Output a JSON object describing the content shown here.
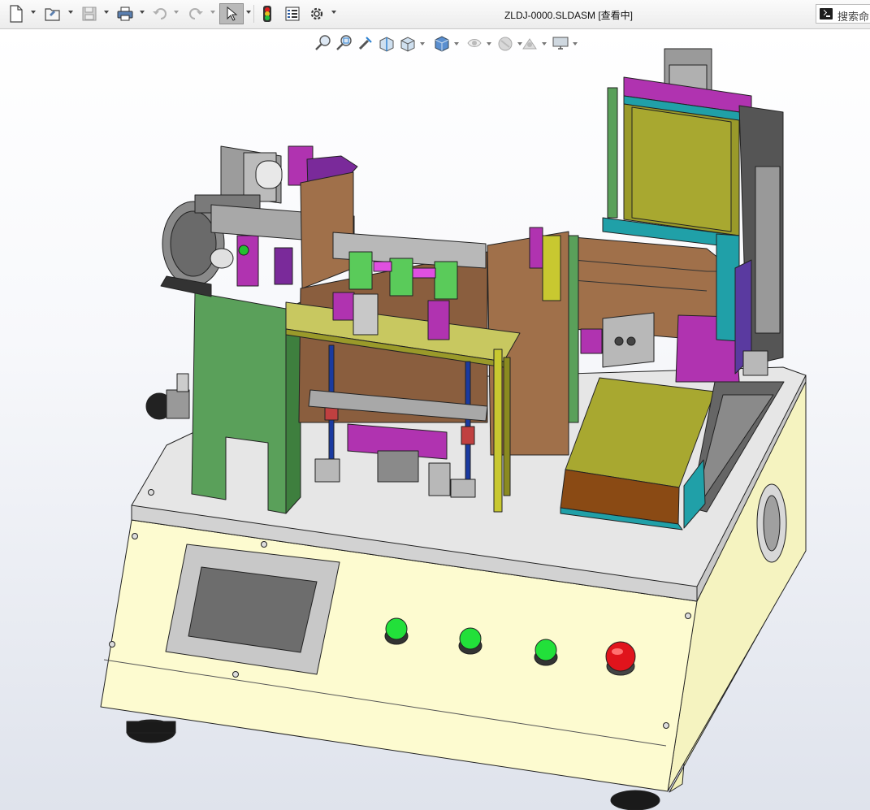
{
  "app": {
    "title": "ZLDJ-0000.SLDASM [查看中]"
  },
  "toolbar": {
    "items": [
      {
        "name": "new-document",
        "icon": "new-document-icon"
      },
      {
        "name": "open",
        "icon": "open-folder-icon"
      },
      {
        "name": "save",
        "icon": "save-disk-icon"
      },
      {
        "name": "print",
        "icon": "printer-icon"
      },
      {
        "name": "undo",
        "icon": "undo-arrow-icon"
      },
      {
        "name": "redo",
        "icon": "redo-arrow-icon"
      },
      {
        "name": "select",
        "icon": "cursor-arrow-icon"
      },
      {
        "name": "rebuild",
        "icon": "traffic-light-icon"
      },
      {
        "name": "file-properties",
        "icon": "file-properties-icon"
      },
      {
        "name": "options",
        "icon": "gear-icon"
      }
    ]
  },
  "search": {
    "placeholder": "搜索命"
  },
  "heads_up_toolbar": {
    "items": [
      {
        "name": "zoom-to-fit",
        "icon": "zoom-to-fit-icon"
      },
      {
        "name": "zoom-to-area",
        "icon": "zoom-area-icon"
      },
      {
        "name": "previous-view",
        "icon": "previous-view-icon"
      },
      {
        "name": "section-view",
        "icon": "section-view-icon"
      },
      {
        "name": "view-orientation",
        "icon": "view-orientation-icon"
      },
      {
        "name": "display-style",
        "icon": "display-style-cube-icon"
      },
      {
        "name": "hide-show-items",
        "icon": "hide-show-eye-icon"
      },
      {
        "name": "edit-appearance",
        "icon": "appearance-sphere-icon"
      },
      {
        "name": "apply-scene",
        "icon": "scene-icon"
      },
      {
        "name": "view-settings",
        "icon": "monitor-icon"
      }
    ]
  },
  "machine": {
    "buttons": [
      {
        "name": "start",
        "color": "#22e03a"
      },
      {
        "name": "reset",
        "color": "#22e03a"
      },
      {
        "name": "mode",
        "color": "#22e03a"
      },
      {
        "name": "emergency-stop",
        "color": "#e0141c"
      }
    ],
    "colors": {
      "cabinet": "#fdfbd0",
      "table_top": "#e4e4e4",
      "green_frame": "#5aa05a",
      "olive_plate": "#9a9a2a",
      "brown_plate": "#a0704a",
      "magenta_parts": "#b033b0",
      "teal_parts": "#20a0a8"
    }
  }
}
